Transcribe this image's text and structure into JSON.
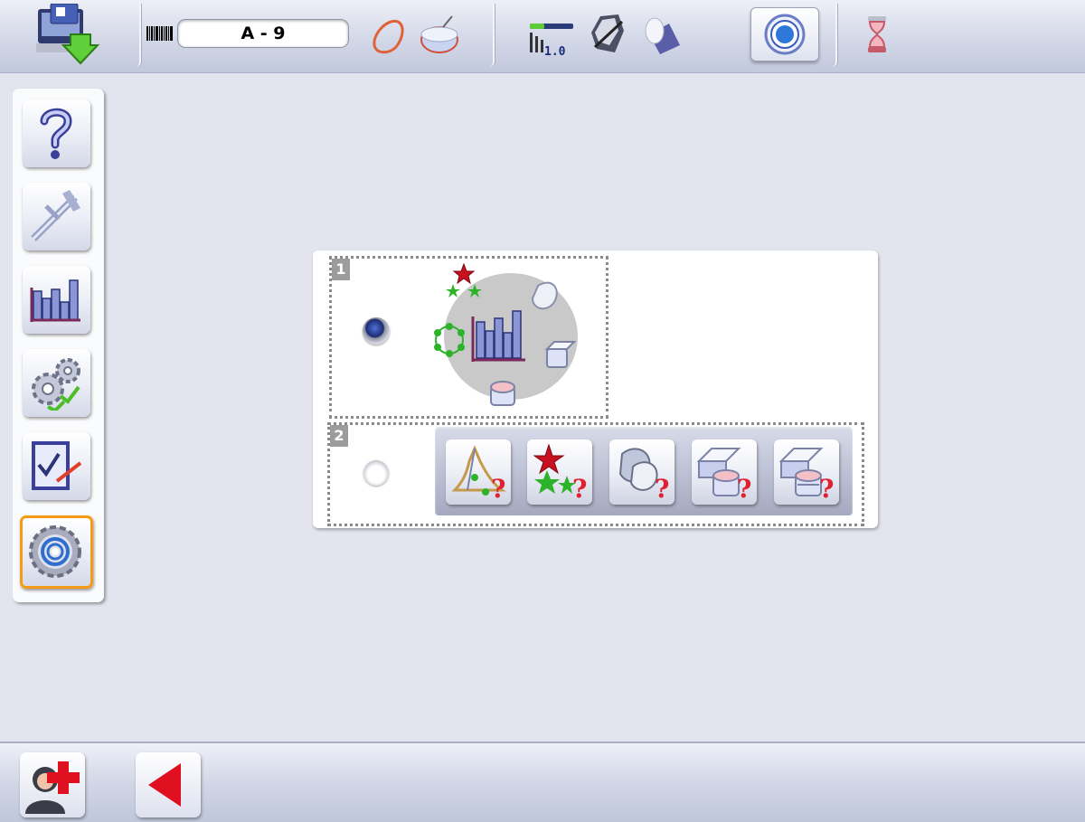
{
  "topbar": {
    "job_value": "A - 9",
    "icons": [
      "download-data-icon",
      "barcode-icon",
      "lens-shape-icon",
      "lens-3d-icon",
      "progress-bar-icon",
      "drilling-tool-icon",
      "lens-edge-icon",
      "mode-button-icon",
      "timer-icon"
    ],
    "progress_label": "1.0"
  },
  "sidebar": {
    "items": [
      {
        "icon": "help-icon"
      },
      {
        "icon": "caliper-icon"
      },
      {
        "icon": "statistics-icon"
      },
      {
        "icon": "settings-gears-icon"
      },
      {
        "icon": "checklist-icon"
      },
      {
        "icon": "gear-target-icon",
        "active": true
      }
    ]
  },
  "panel": {
    "option1": {
      "number": "1",
      "selected": true
    },
    "option2": {
      "number": "2",
      "selected": false,
      "buttons": [
        "triangle-help-icon",
        "stars-help-icon",
        "lens-help-icon",
        "bevel-help-icon",
        "groove-help-icon"
      ]
    }
  },
  "bottombar": {
    "icons": [
      "user-add-icon",
      "back-arrow-icon"
    ]
  },
  "colors": {
    "accent_active": "#f39b17",
    "back_arrow": "#e01020",
    "background": "#e3e4ee"
  }
}
